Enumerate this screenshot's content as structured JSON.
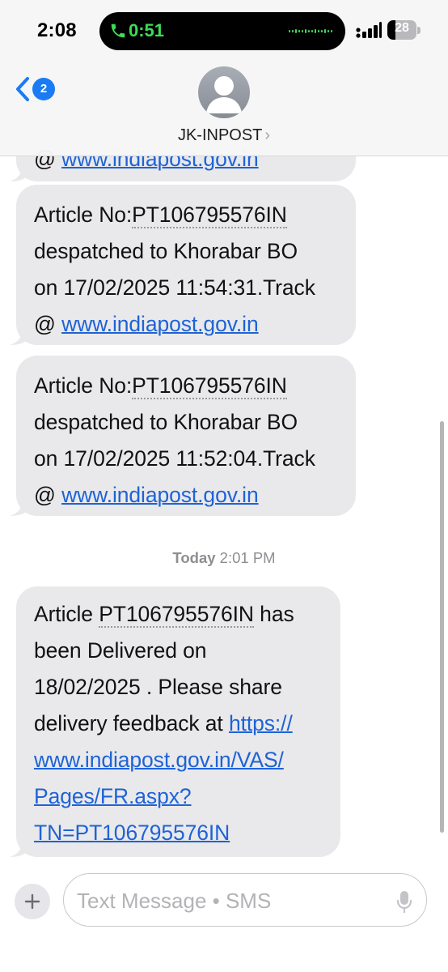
{
  "status_bar": {
    "time": "2:08",
    "call_timer": "0:51",
    "battery_level": "28",
    "battery_fraction": 0.28,
    "icons": [
      "phone-icon",
      "waveform-icon",
      "signal-icon",
      "battery-icon"
    ]
  },
  "header": {
    "back_icon": "chevron-left-icon",
    "unread_count": "2",
    "avatar_icon": "person-silhouette-icon",
    "contact_name": "JK-INPOST",
    "contact_chevron": "›"
  },
  "messages": [
    {
      "lines": [
        [
          "@ ",
          "www.indiapost.gov.in"
        ]
      ]
    },
    {
      "article_label": "Article No:",
      "article_no": "PT106795576IN",
      "line2": "despatched to Khorabar BO",
      "line3": "on 17/02/2025 11:54:31.Track",
      "line4_prefix": "@ ",
      "link": "www.indiapost.gov.in"
    },
    {
      "article_label": "Article No:",
      "article_no": "PT106795576IN",
      "line2": "despatched to Khorabar BO",
      "line3": "on 17/02/2025 11:52:04.Track",
      "line4_prefix": "@ ",
      "link": "www.indiapost.gov.in"
    }
  ],
  "timestamp": {
    "day": "Today",
    "time": "2:01 PM"
  },
  "last_message": {
    "prefix": "Article ",
    "article_no": "PT106795576IN",
    "suffix": " has",
    "line2": "been Delivered on",
    "line3": "18/02/2025 . Please share",
    "line4_text": "delivery feedback at ",
    "line4_link": "https://",
    "link_line5": "www.indiapost.gov.in/VAS/",
    "link_line6": "Pages/FR.aspx?",
    "link_line7": "TN=PT106795576IN"
  },
  "input_bar": {
    "plus_icon": "plus-icon",
    "placeholder": "Text Message • SMS",
    "value": "",
    "mic_icon": "microphone-icon"
  }
}
